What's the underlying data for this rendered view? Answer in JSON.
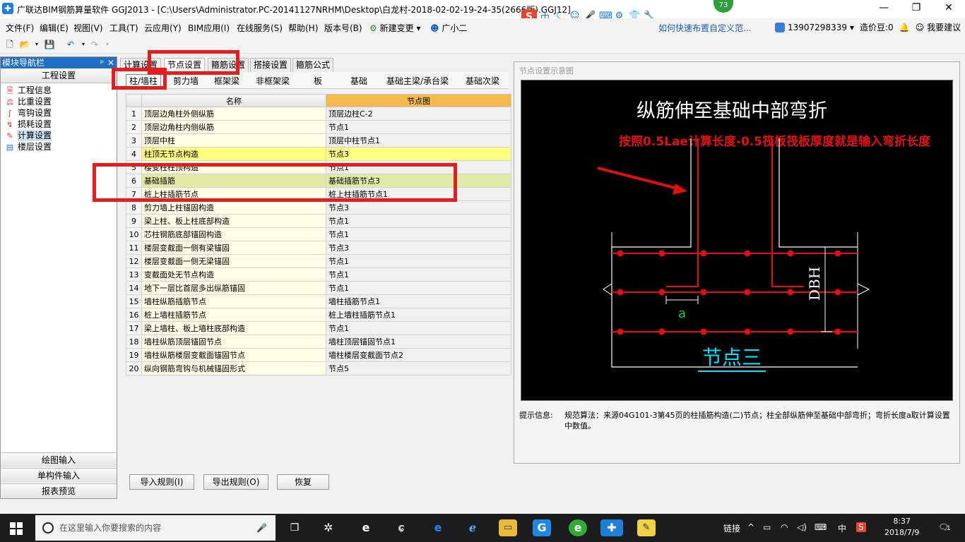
{
  "window": {
    "title": "广联达BIM钢筋算量软件 GGJ2013 - [C:\\Users\\Administrator.PC-20141127NRHM\\Desktop\\白龙村-2018-02-02-19-24-35(2666版).GGJ12]",
    "min_glyph": "—",
    "max_glyph": "❐",
    "close_glyph": "✕"
  },
  "ime": {
    "sogou": "S",
    "lang": "中",
    "badge": "73"
  },
  "menu": [
    "文件(F)",
    "编辑(E)",
    "视图(V)",
    "工具(T)",
    "云应用(Y)",
    "BIM应用(I)",
    "在线服务(S)",
    "帮助(H)",
    "版本号(B)",
    "新建变更",
    "广小二"
  ],
  "ad_text": "如何快速布置自定义范...",
  "user": {
    "phone": "13907298339",
    "beans": "造价豆:0",
    "suggest": "我要建议"
  },
  "nav": {
    "header": "模块导航栏",
    "pin": "ᵖ",
    "close": "✕",
    "section": "工程设置",
    "items": [
      {
        "label": "工程信息"
      },
      {
        "label": "比重设置"
      },
      {
        "label": "弯钩设置"
      },
      {
        "label": "损耗设置"
      },
      {
        "label": "计算设置"
      },
      {
        "label": "楼层设置"
      }
    ],
    "bottom": [
      "绘图输入",
      "单构件输入",
      "报表预览"
    ]
  },
  "tabs": [
    "计算设置",
    "节点设置",
    "箍筋设置",
    "搭接设置",
    "箍筋公式"
  ],
  "subtabs": [
    "柱/墙柱",
    "剪力墙",
    "框架梁",
    "非框架梁",
    "板",
    "基础",
    "基础主梁/承台梁",
    "基础次梁"
  ],
  "grid": {
    "headers": {
      "name": "名称",
      "node": "节点图"
    },
    "rows": [
      {
        "n": "1",
        "name": "顶层边角柱外侧纵筋",
        "node": "顶层边柱C-2"
      },
      {
        "n": "2",
        "name": "顶层边角柱内侧纵筋",
        "node": "节点1"
      },
      {
        "n": "3",
        "name": "顶层中柱",
        "node": "顶层中柱节点1"
      },
      {
        "n": "4",
        "name": "柱顶无节点构造",
        "node": "节点3"
      },
      {
        "n": "5",
        "name": "楼变柱柱顶构造",
        "node": "节点1"
      },
      {
        "n": "6",
        "name": "基础插筋",
        "node": "基础插筋节点3"
      },
      {
        "n": "7",
        "name": "桩上柱插筋节点",
        "node": "桩上柱插筋节点1"
      },
      {
        "n": "8",
        "name": "剪力墙上柱锚固构造",
        "node": "节点3"
      },
      {
        "n": "9",
        "name": "梁上柱、板上柱底部构造",
        "node": "节点1"
      },
      {
        "n": "10",
        "name": "芯柱钢筋底部锚固构造",
        "node": "节点1"
      },
      {
        "n": "11",
        "name": "楼层变截面一侧有梁锚固",
        "node": "节点3"
      },
      {
        "n": "12",
        "name": "楼层变截面一侧无梁锚固",
        "node": "节点1"
      },
      {
        "n": "13",
        "name": "变截面处无节点构造",
        "node": "节点1"
      },
      {
        "n": "14",
        "name": "地下一层比首层多出纵筋锚固",
        "node": "节点1"
      },
      {
        "n": "15",
        "name": "墙柱纵筋插筋节点",
        "node": "墙柱插筋节点1"
      },
      {
        "n": "16",
        "name": "桩上墙柱插筋节点",
        "node": "桩上墙柱插筋节点1"
      },
      {
        "n": "17",
        "name": "梁上墙柱、板上墙柱底部构造",
        "node": "节点1"
      },
      {
        "n": "18",
        "name": "墙柱纵筋顶层锚固节点",
        "node": "墙柱顶层锚固节点1"
      },
      {
        "n": "19",
        "name": "墙柱纵筋楼层变截面锚固节点",
        "node": "墙柱楼层变截面节点2"
      },
      {
        "n": "20",
        "name": "纵向钢筋弯钩与机械锚固形式",
        "node": "节点5"
      }
    ]
  },
  "preview": {
    "title": "节点设置示意图",
    "diagram_title": "纵筋伸至基础中部弯折",
    "annotation": "按照0.5Lae计算长度-0.5筏板筏板厚度就是输入弯折长度",
    "dim_a": "a",
    "dim_dbh": "DBH",
    "node_label": "节点三",
    "colors": {
      "rebar": "#e01010",
      "outline": "#ffffff",
      "label": "#00e0ff",
      "dim_a": "#22cc22",
      "annotation": "#e01010"
    }
  },
  "tip": {
    "label": "提示信息:",
    "text": "规范算法：来源04G101-3第45页的柱插筋构造(二)节点；柱全部纵筋伸至基础中部弯折；弯折长度a取计算设置中数值。"
  },
  "buttons": {
    "import": "导入规则(I)",
    "export": "导出规则(O)",
    "restore": "恢复"
  },
  "taskbar": {
    "search_placeholder": "在这里输入你要搜索的内容",
    "link": "链接",
    "ime": "中",
    "time": "8:37",
    "date": "2018/7/9",
    "notif": "1"
  }
}
